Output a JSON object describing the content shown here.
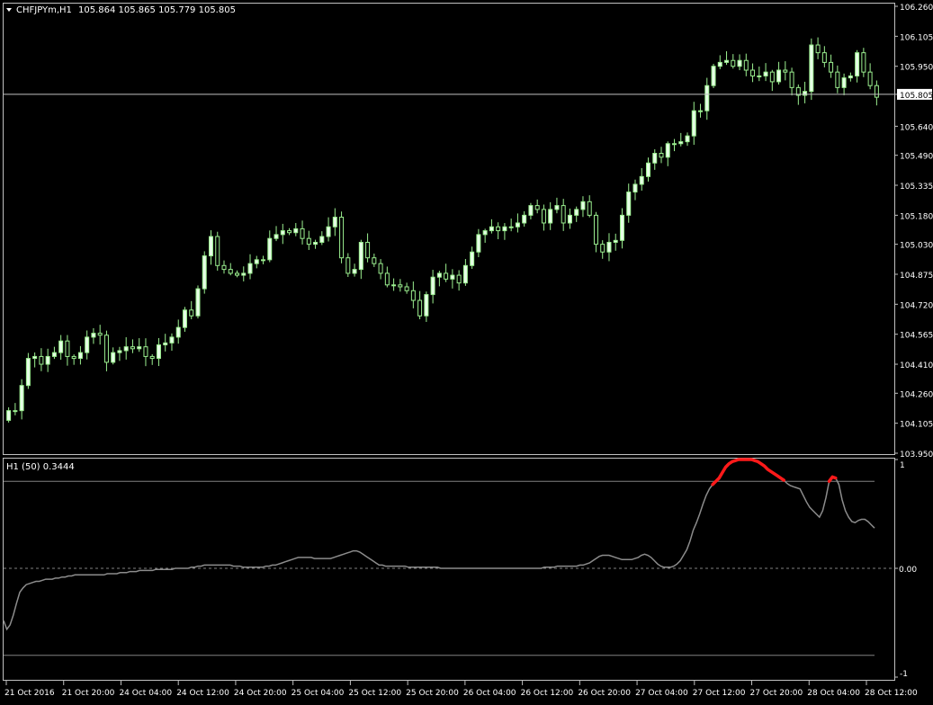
{
  "header": {
    "symbol": "CHFJPYm,H1",
    "ohlc": "105.864 105.865 105.779 105.805"
  },
  "indicator": {
    "label": "H1 (50) 0.3444"
  },
  "colors": {
    "background": "#000000",
    "bull_candle": "#e6ffe6",
    "bear_candle": "#000000",
    "candle_wick": "#9bef8f",
    "grid": "#c0c0c0",
    "indicator_line": "#8c8c8c",
    "indicator_highlight": "#ff1a1a",
    "axis_text": "#ffffff"
  },
  "chart_data": [
    {
      "type": "candlestick",
      "ylim": [
        103.95,
        106.26
      ],
      "y_ticks": [
        "106.260",
        "106.105",
        "105.950",
        "105.805",
        "105.640",
        "105.490",
        "105.335",
        "105.180",
        "105.030",
        "104.875",
        "104.720",
        "104.565",
        "104.410",
        "104.260",
        "104.105",
        "103.950"
      ],
      "current_price": 105.805,
      "x_ticks": [
        "21 Oct 2016",
        "21 Oct 20:00",
        "24 Oct 04:00",
        "24 Oct 12:00",
        "24 Oct 20:00",
        "25 Oct 04:00",
        "25 Oct 12:00",
        "25 Oct 20:00",
        "26 Oct 04:00",
        "26 Oct 12:00",
        "26 Oct 20:00",
        "27 Oct 04:00",
        "27 Oct 12:00",
        "27 Oct 20:00",
        "28 Oct 04:00",
        "28 Oct 12:00"
      ],
      "closes": [
        104.17,
        104.17,
        104.3,
        104.44,
        104.45,
        104.41,
        104.45,
        104.47,
        104.53,
        104.45,
        104.44,
        104.47,
        104.55,
        104.57,
        104.56,
        104.42,
        104.47,
        104.48,
        104.5,
        104.49,
        104.5,
        104.45,
        104.44,
        104.51,
        104.52,
        104.55,
        104.6,
        104.69,
        104.66,
        104.8,
        104.97,
        105.07,
        104.92,
        104.9,
        104.88,
        104.87,
        104.88,
        104.93,
        104.95,
        104.95,
        105.06,
        105.08,
        105.1,
        105.09,
        105.11,
        105.06,
        105.03,
        105.04,
        105.07,
        105.12,
        105.17,
        104.96,
        104.88,
        104.9,
        105.04,
        104.96,
        104.93,
        104.88,
        104.82,
        104.82,
        104.81,
        104.79,
        104.74,
        104.66,
        104.77,
        104.86,
        104.88,
        104.85,
        104.87,
        104.83,
        104.92,
        104.99,
        105.08,
        105.1,
        105.12,
        105.1,
        105.12,
        105.12,
        105.14,
        105.18,
        105.23,
        105.21,
        105.14,
        105.21,
        105.23,
        105.14,
        105.18,
        105.21,
        105.25,
        105.18,
        105.03,
        104.99,
        105.04,
        105.05,
        105.18,
        105.3,
        105.34,
        105.38,
        105.45,
        105.5,
        105.48,
        105.55,
        105.55,
        105.56,
        105.59,
        105.72,
        105.72,
        105.85,
        105.95,
        105.97,
        105.98,
        105.95,
        105.98,
        105.93,
        105.9,
        105.9,
        105.92,
        105.87,
        105.93,
        105.92,
        105.84,
        105.8,
        105.82,
        106.06,
        106.02,
        105.97,
        105.92,
        105.84,
        105.89,
        105.9,
        106.02,
        105.92,
        105.85,
        105.79
      ]
    },
    {
      "type": "line",
      "ylim": [
        -1,
        1
      ],
      "y_ticks": [
        "1",
        "0.00",
        "-1"
      ],
      "reference_levels": [
        0.8,
        0,
        -0.8
      ],
      "threshold": 0.8,
      "values": [
        -0.48,
        -0.56,
        -0.52,
        -0.43,
        -0.32,
        -0.22,
        -0.18,
        -0.15,
        -0.14,
        -0.13,
        -0.12,
        -0.12,
        -0.11,
        -0.1,
        -0.1,
        -0.1,
        -0.09,
        -0.09,
        -0.08,
        -0.08,
        -0.07,
        -0.07,
        -0.06,
        -0.06,
        -0.06,
        -0.06,
        -0.06,
        -0.06,
        -0.06,
        -0.06,
        -0.06,
        -0.06,
        -0.05,
        -0.05,
        -0.05,
        -0.05,
        -0.04,
        -0.04,
        -0.04,
        -0.03,
        -0.03,
        -0.03,
        -0.02,
        -0.02,
        -0.02,
        -0.02,
        -0.02,
        -0.01,
        -0.01,
        -0.01,
        -0.01,
        -0.01,
        -0.01,
        0.0,
        0.0,
        0.0,
        0.0,
        0.0,
        0.01,
        0.01,
        0.02,
        0.02,
        0.03,
        0.03,
        0.03,
        0.03,
        0.03,
        0.03,
        0.03,
        0.03,
        0.03,
        0.02,
        0.02,
        0.02,
        0.01,
        0.01,
        0.01,
        0.01,
        0.01,
        0.01,
        0.01,
        0.02,
        0.02,
        0.03,
        0.03,
        0.04,
        0.05,
        0.06,
        0.07,
        0.08,
        0.09,
        0.1,
        0.1,
        0.1,
        0.1,
        0.1,
        0.09,
        0.09,
        0.09,
        0.09,
        0.09,
        0.09,
        0.1,
        0.11,
        0.12,
        0.13,
        0.14,
        0.15,
        0.16,
        0.16,
        0.15,
        0.13,
        0.11,
        0.09,
        0.07,
        0.05,
        0.03,
        0.03,
        0.02,
        0.02,
        0.02,
        0.02,
        0.02,
        0.02,
        0.02,
        0.01,
        0.01,
        0.01,
        0.01,
        0.01,
        0.01,
        0.01,
        0.01,
        0.01,
        0.01,
        0.0,
        0.0,
        0.0,
        0.0,
        0.0,
        0.0,
        0.0,
        0.0,
        0.0,
        0.0,
        0.0,
        0.0,
        0.0,
        0.0,
        0.0,
        0.0,
        0.0,
        0.0,
        0.0,
        0.0,
        0.0,
        0.0,
        0.0,
        0.0,
        0.0,
        0.0,
        0.0,
        0.0,
        0.0,
        0.0,
        0.0,
        0.0,
        0.01,
        0.01,
        0.01,
        0.01,
        0.02,
        0.02,
        0.02,
        0.02,
        0.02,
        0.02,
        0.02,
        0.03,
        0.03,
        0.04,
        0.05,
        0.07,
        0.09,
        0.11,
        0.12,
        0.12,
        0.12,
        0.11,
        0.1,
        0.09,
        0.08,
        0.08,
        0.08,
        0.08,
        0.09,
        0.1,
        0.12,
        0.13,
        0.12,
        0.1,
        0.07,
        0.04,
        0.02,
        0.01,
        0.01,
        0.01,
        0.02,
        0.04,
        0.07,
        0.12,
        0.17,
        0.25,
        0.35,
        0.42,
        0.5,
        0.59,
        0.67,
        0.73,
        0.77,
        0.8,
        0.83,
        0.88,
        0.93,
        0.96,
        0.98,
        0.99,
        1.0,
        1.0,
        1.0,
        1.0,
        1.0,
        0.99,
        0.98,
        0.96,
        0.94,
        0.91,
        0.89,
        0.87,
        0.85,
        0.83,
        0.81,
        0.78,
        0.76,
        0.75,
        0.74,
        0.73,
        0.67,
        0.61,
        0.56,
        0.53,
        0.5,
        0.47,
        0.53,
        0.65,
        0.8,
        0.84,
        0.83,
        0.77,
        0.63,
        0.53,
        0.47,
        0.43,
        0.42,
        0.44,
        0.45,
        0.45,
        0.43,
        0.4,
        0.37
      ]
    }
  ]
}
